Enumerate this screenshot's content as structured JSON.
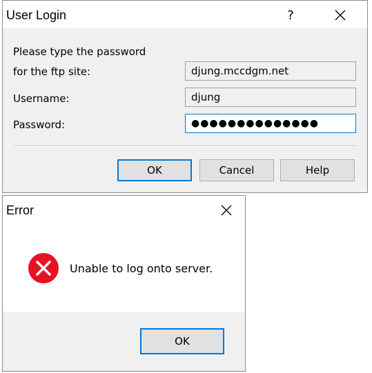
{
  "login": {
    "title": "User Login",
    "help_glyph": "?",
    "prompt_line1": "Please type the password",
    "prompt_line2": "for the ftp site:",
    "site_value": "djung.mccdgm.net",
    "username_label": "Username:",
    "username_value": "djung",
    "password_label": "Password:",
    "password_value": "●●●●●●●●●●●●●●",
    "ok_label": "OK",
    "cancel_label": "Cancel",
    "help_label": "Help"
  },
  "error": {
    "title": "Error",
    "message": "Unable to log onto server.",
    "ok_label": "OK"
  },
  "colors": {
    "accent": "#0078d7",
    "error_red": "#e81123",
    "dialog_bg": "#f0f0f0"
  }
}
